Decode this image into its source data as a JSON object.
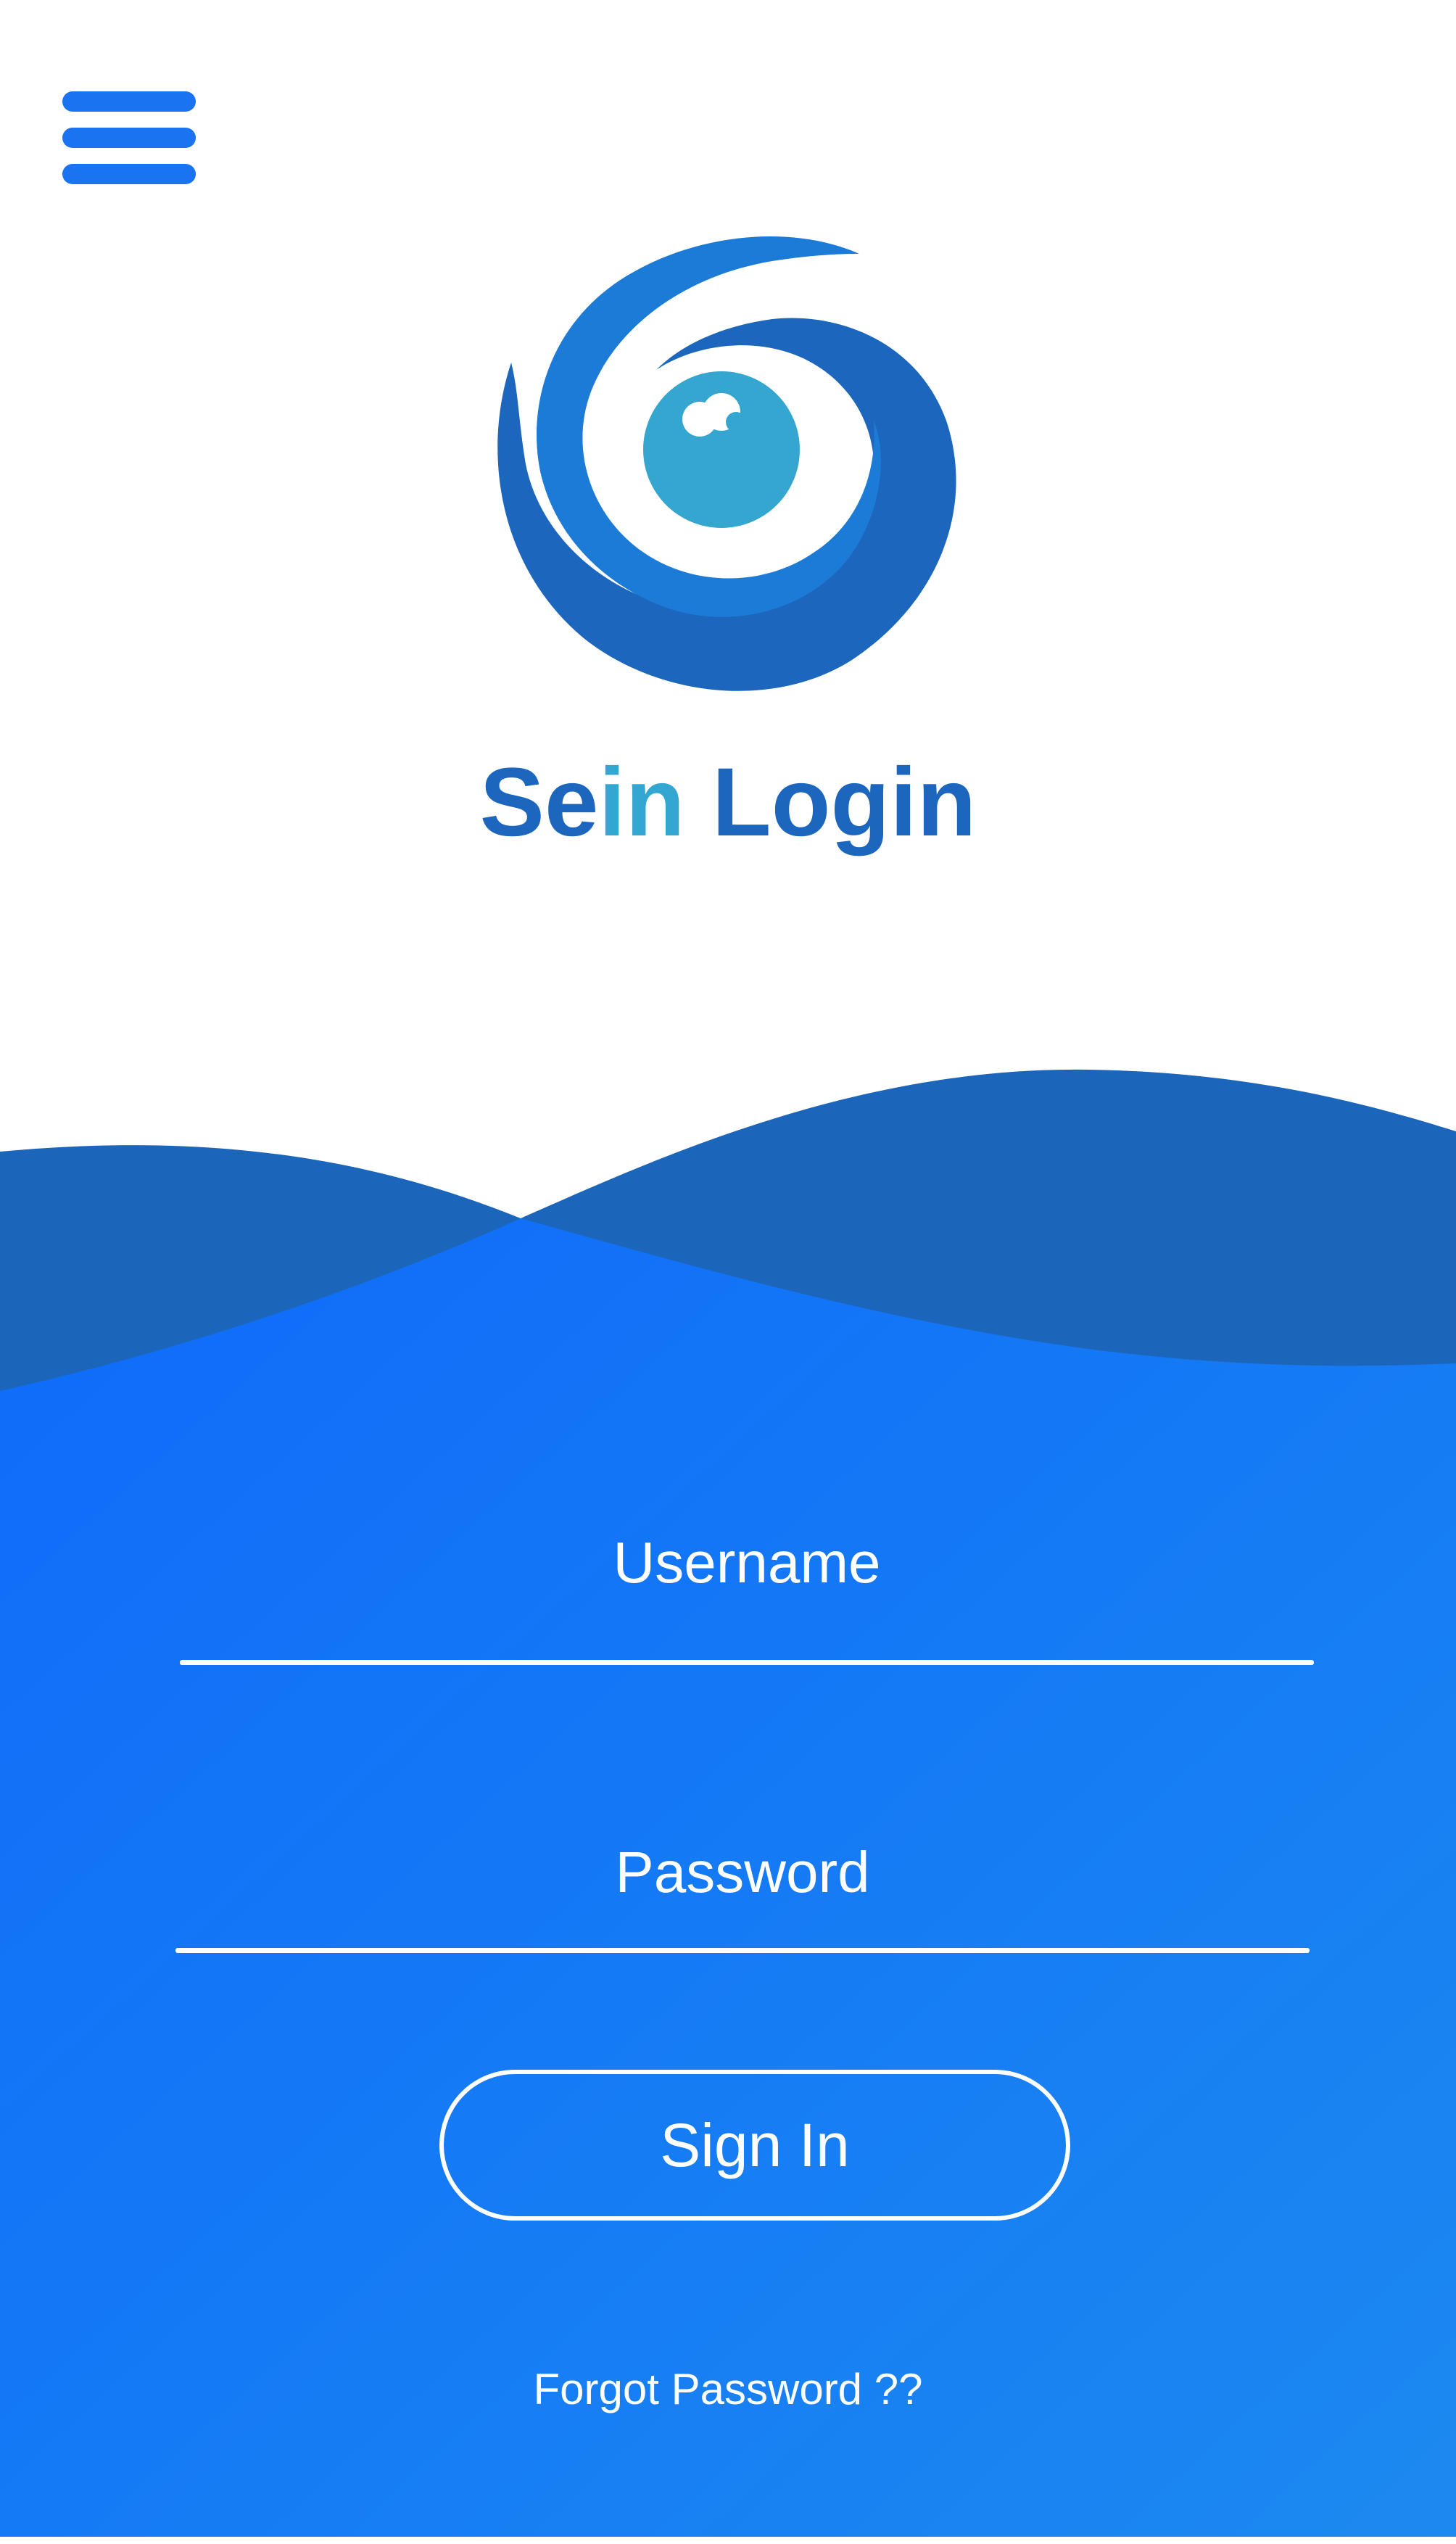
{
  "app": {
    "title_primary": "Se",
    "title_accent": "in",
    "title_secondary": "Login"
  },
  "menu": {
    "icon": "hamburger-menu-icon"
  },
  "logo": {
    "icon": "swirl-eye-logo"
  },
  "form": {
    "username_placeholder": "Username",
    "password_placeholder": "Password",
    "signin_label": "Sign In",
    "forgot_label": "Forgot Password ??"
  },
  "colors": {
    "primary_blue": "#1a73f0",
    "dark_wave": "#1c67bd",
    "accent_cyan": "#33a6d1",
    "bottom_gradient_start": "#0e6ef8",
    "bottom_gradient_end": "#1b86f0"
  }
}
